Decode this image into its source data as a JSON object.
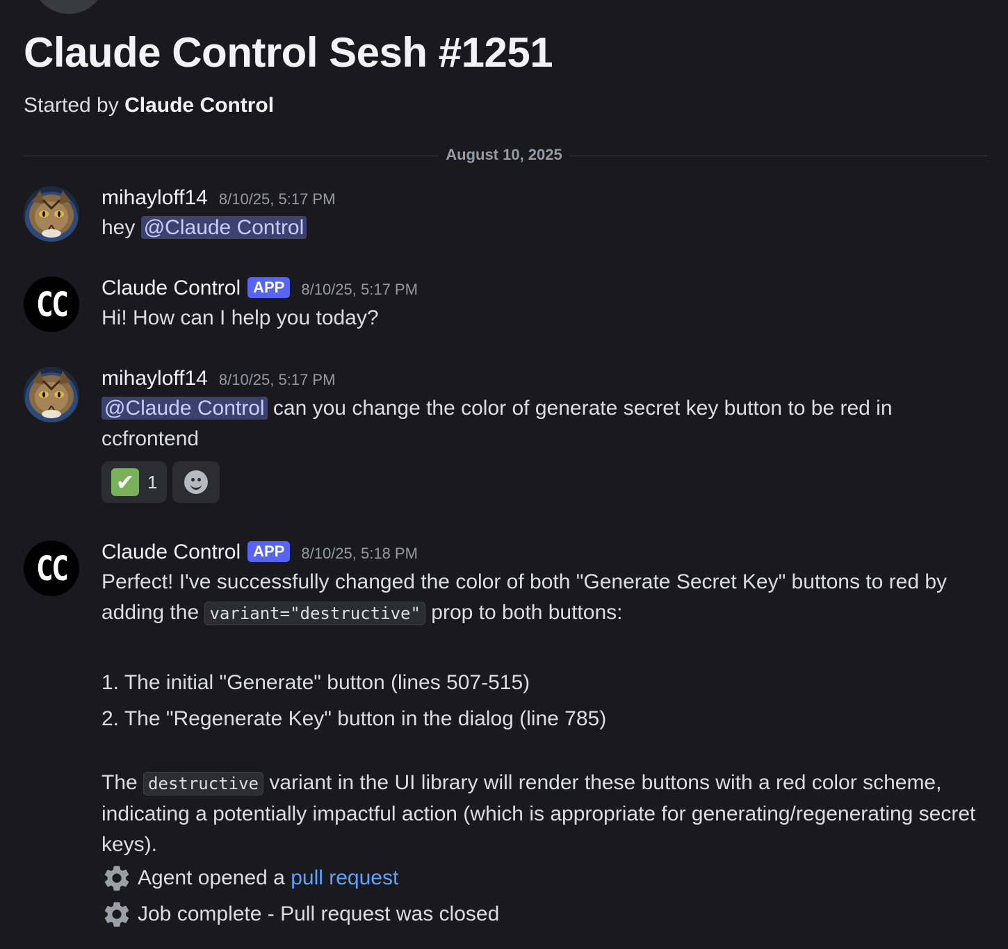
{
  "thread": {
    "title": "Claude Control Sesh #1251",
    "started_by_prefix": "Started by",
    "started_by_name": "Claude Control"
  },
  "date_divider": "August 10, 2025",
  "messages": [
    {
      "author": "mihayloff14",
      "timestamp": "8/10/25, 5:17 PM",
      "text": "hey",
      "mention": "@Claude Control"
    },
    {
      "author": "Claude Control",
      "badge": "APP",
      "avatar_text": "CC",
      "timestamp": "8/10/25, 5:17 PM",
      "text": "Hi! How can I help you today?"
    },
    {
      "author": "mihayloff14",
      "timestamp": "8/10/25, 5:17 PM",
      "mention": "@Claude Control",
      "text": "can you change the color of generate secret key button to be red in ccfrontend",
      "reactions": [
        {
          "emoji": "✔",
          "icon": "check-mark-button",
          "count": "1"
        }
      ]
    },
    {
      "author": "Claude Control",
      "badge": "APP",
      "avatar_text": "CC",
      "timestamp": "8/10/25, 5:18 PM",
      "para1_a": "Perfect! I've successfully changed the color of both \"Generate Secret Key\" buttons to red by adding the",
      "para1_code": "variant=\"destructive\"",
      "para1_b": "prop to both buttons:",
      "list": [
        "1. The initial \"Generate\" button (lines 507-515)",
        "2. The \"Regenerate Key\" button in the dialog (line 785)"
      ],
      "para2_a": "The",
      "para2_code": "destructive",
      "para2_b": "variant in the UI library will render these buttons with a red color scheme, indicating a potentially impactful action (which is appropriate for generating/regenerating secret keys).",
      "status1_text": "Agent opened a",
      "status1_link": "pull request",
      "status2_text": "Job complete - Pull request was closed"
    }
  ],
  "colors": {
    "background": "#1a1a1e",
    "mention_bg": "#3c4270",
    "app_badge": "#5865f2",
    "link": "#5ca3ff",
    "reaction_check": "#78b159"
  }
}
